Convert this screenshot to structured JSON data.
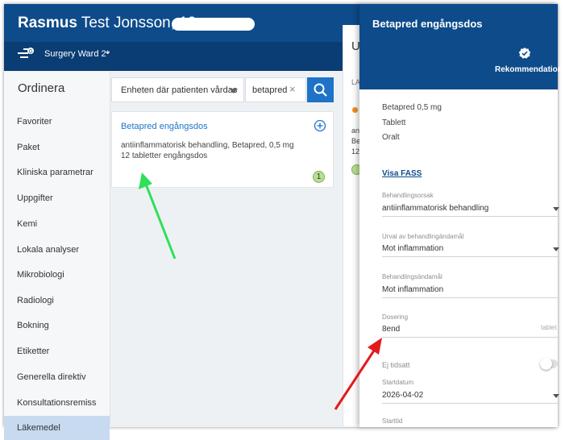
{
  "header": {
    "patient_name_bold": "Rasmus",
    "patient_name_rest": " Test Jonsson, 19",
    "ward_label": "Surgery Ward 2*",
    "ward_chevron": "⌄"
  },
  "nav": {
    "title": "Ordinera",
    "items": [
      {
        "label": "Favoriter"
      },
      {
        "label": "Paket"
      },
      {
        "label": "Kliniska parametrar"
      },
      {
        "label": "Uppgifter"
      },
      {
        "label": "Kemi"
      },
      {
        "label": "Lokala analyser"
      },
      {
        "label": "Mikrobiologi"
      },
      {
        "label": "Radiologi"
      },
      {
        "label": "Bokning"
      },
      {
        "label": "Etiketter"
      },
      {
        "label": "Generella direktiv"
      },
      {
        "label": "Konsultationsremiss"
      },
      {
        "label": "Läkemedel",
        "active": true
      }
    ]
  },
  "search": {
    "filter_value": "Enheten där patienten vårdas",
    "query": "betapred",
    "clear": "×"
  },
  "result": {
    "title": "Betapred engångsdos",
    "line1": "antiinflammatorisk behandling, Betapred, 0,5 mg",
    "line2": "12 tabletter engångsdos",
    "badge": "1"
  },
  "background_panel": {
    "heading": "U",
    "label": "LA",
    "line1": "an",
    "line2": "Be",
    "line3": "12"
  },
  "drawer": {
    "title": "Betapred engångsdos",
    "recommendation_label": "Rekommendation",
    "summary": [
      "Betapred 0,5 mg",
      "Tablett",
      "Oralt"
    ],
    "fass_link": "Visa FASS",
    "fields": {
      "reason_label": "Behandlingsorsak",
      "reason_value": "antiinflammatorisk behandling",
      "purpose_select_label": "Urval av behandlingändamål",
      "purpose_select_value": "Mot inflammation",
      "purpose_label": "Behandlingsändamål",
      "purpose_value": "Mot inflammation",
      "dosing_label": "Dosering",
      "dosing_value": "8end",
      "dosing_unit": "tablet",
      "untimed_label": "Ej tidsatt",
      "start_date_label": "Startdatum",
      "start_date_value": "2026-04-02",
      "start_time_label": "Starttid"
    },
    "untimed_toggle_on": false
  },
  "colors": {
    "header_blue": "#0e4b8a",
    "link_blue": "#1e73c8",
    "annotation_green": "#2ee05a",
    "annotation_red": "#e21b1b"
  }
}
